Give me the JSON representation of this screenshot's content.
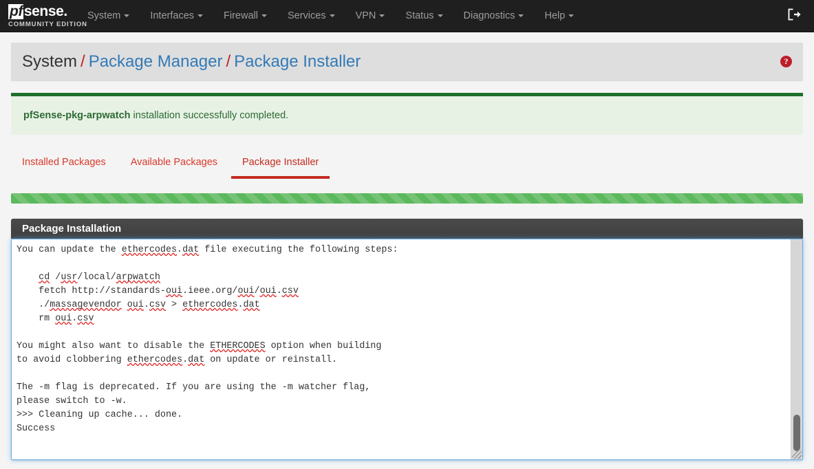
{
  "navbar": {
    "brand": {
      "pf": "pf",
      "sense": "sense",
      "dot": ".",
      "sub": "COMMUNITY EDITION"
    },
    "items": [
      {
        "label": "System"
      },
      {
        "label": "Interfaces"
      },
      {
        "label": "Firewall"
      },
      {
        "label": "Services"
      },
      {
        "label": "VPN"
      },
      {
        "label": "Status"
      },
      {
        "label": "Diagnostics"
      },
      {
        "label": "Help"
      }
    ],
    "logout_icon": "sign-out-icon"
  },
  "breadcrumb": {
    "root": "System",
    "sep": "/",
    "link1": "Package Manager",
    "link2": "Package Installer",
    "help_icon": "?",
    "help_icon_name": "question-circle-icon"
  },
  "alert": {
    "package": "pfSense-pkg-arpwatch",
    "message": " installation successfully completed."
  },
  "tabs": [
    {
      "label": "Installed Packages",
      "active": false
    },
    {
      "label": "Available Packages",
      "active": false
    },
    {
      "label": "Package Installer",
      "active": true
    }
  ],
  "progress": {
    "percent": 100,
    "color": "#5cb85c"
  },
  "panel": {
    "title": "Package Installation",
    "console_lines": [
      "--",
      "You can update the ethercodes.dat file executing the following steps:",
      "",
      "    cd /usr/local/arpwatch",
      "    fetch http://standards-oui.ieee.org/oui/oui.csv",
      "    ./massagevendor oui.csv > ethercodes.dat",
      "    rm oui.csv",
      "",
      "You might also want to disable the ETHERCODES option when building",
      "to avoid clobbering ethercodes.dat on update or reinstall.",
      "",
      "The -m flag is deprecated. If you are using the -m watcher flag,",
      "please switch to -w.",
      ">>> Cleaning up cache... done.",
      "Success"
    ]
  },
  "colors": {
    "navbar_bg": "#1f1f1f",
    "accent_red": "#c32b20",
    "link_blue": "#337ab7",
    "success_green": "#5cb85c",
    "alert_border": "#1d6f2b",
    "focus_blue": "#66afe9"
  }
}
